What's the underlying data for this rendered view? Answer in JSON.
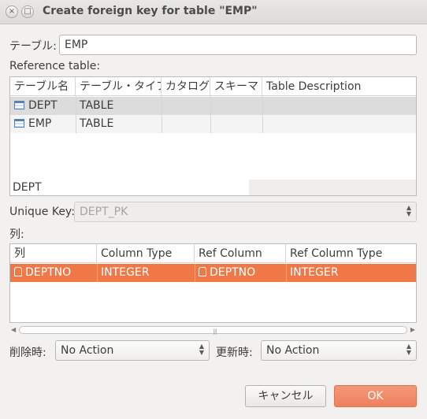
{
  "window": {
    "title": "Create foreign key for table \"EMP\"",
    "close_glyph": "×",
    "max_glyph": "□"
  },
  "table_field": {
    "label": "テーブル:",
    "value": "EMP"
  },
  "reference": {
    "label": "Reference table:",
    "columns": [
      "テーブル名",
      "テーブル・タイプ",
      "カタログ",
      "スキーマ",
      "Table Description"
    ],
    "rows": [
      {
        "icon": "table-icon",
        "name": "DEPT",
        "type": "TABLE",
        "catalog": "",
        "schema": "",
        "description": ""
      },
      {
        "icon": "table-icon",
        "name": "EMP",
        "type": "TABLE",
        "catalog": "",
        "schema": "",
        "description": ""
      }
    ],
    "selected_name": "DEPT"
  },
  "unique_key": {
    "label": "Unique Key:",
    "value": "DEPT_PK",
    "enabled": false
  },
  "columns_section": {
    "label": "列:",
    "columns": [
      "列",
      "Column Type",
      "Ref Column",
      "Ref Column Type"
    ],
    "rows": [
      {
        "icon": "key-icon",
        "column": "DEPTNO",
        "column_type": "INTEGER",
        "ref_column": "DEPTNO",
        "ref_column_type": "INTEGER",
        "selected": true
      }
    ]
  },
  "on_delete": {
    "label": "削除時:",
    "value": "No Action"
  },
  "on_update": {
    "label": "更新時:",
    "value": "No Action"
  },
  "buttons": {
    "cancel": "キャンセル",
    "ok": "OK"
  },
  "colors": {
    "accent": "#f07746",
    "selection": "#f07746"
  }
}
